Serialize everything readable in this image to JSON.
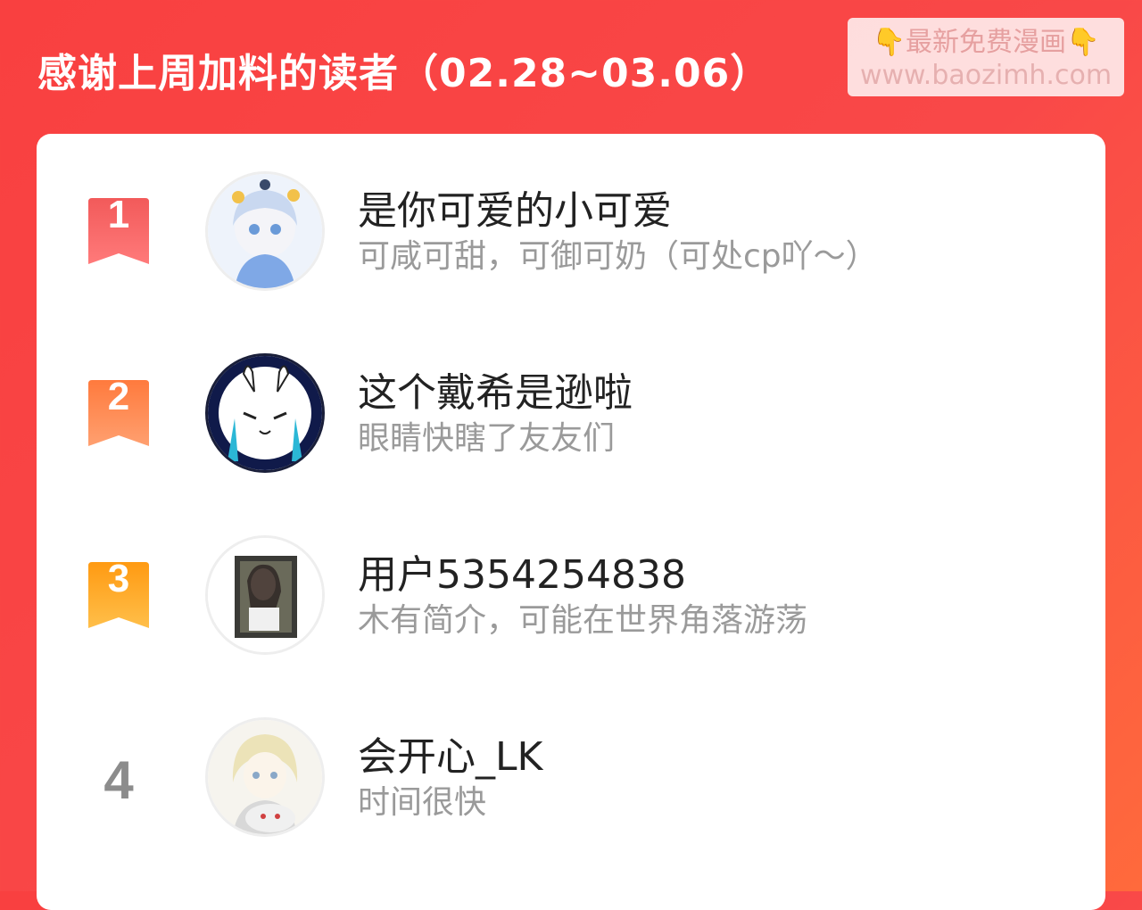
{
  "header": {
    "title": "感谢上周加料的读者（02.28~03.06）"
  },
  "watermark": {
    "line1_emoji_left": "👇",
    "line1_text": "最新免费漫画",
    "line1_emoji_right": "👇",
    "line2": "www.baozimh.com"
  },
  "readers": [
    {
      "rank": "1",
      "name": "是你可爱的小可爱",
      "bio": "可咸可甜，可御可奶（可处cp吖～）",
      "badge_color": "#f45a5a"
    },
    {
      "rank": "2",
      "name": "这个戴希是逊啦",
      "bio": "眼睛快瞎了友友们",
      "badge_color": "#ff7f45"
    },
    {
      "rank": "3",
      "name": "用户5354254838",
      "bio": "木有简介，可能在世界角落游荡",
      "badge_color": "#ffa31f"
    },
    {
      "rank": "4",
      "name": "会开心_LK",
      "bio": "时间很快",
      "badge_color": ""
    }
  ],
  "colors": {
    "background": "#f94040",
    "card": "#ffffff",
    "name_text": "#222222",
    "bio_text": "#9a9a9a",
    "rank_plain": "#8c8c8c"
  }
}
